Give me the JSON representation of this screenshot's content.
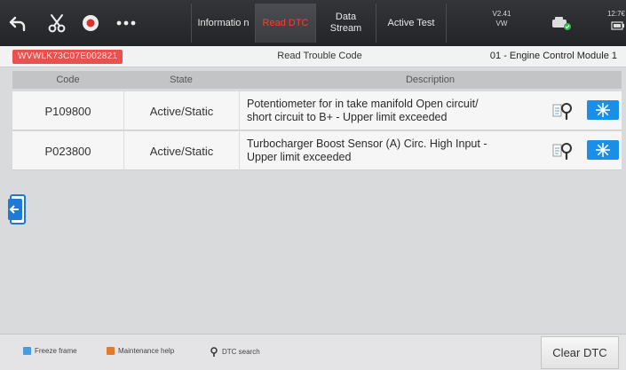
{
  "toolbar": {
    "icons": [
      "back-arrow-icon",
      "scissors-icon",
      "record-icon",
      "more-icon"
    ],
    "tabs": [
      {
        "label": "Informatio n",
        "active": false
      },
      {
        "label": "Read DTC",
        "active": true
      },
      {
        "label": "Data Stream",
        "active": false
      },
      {
        "label": "Active Test",
        "active": false
      }
    ],
    "version": "V2.41",
    "make": "VW",
    "time": "12:7€",
    "status_icons": [
      "vehicle-status-icon",
      "battery-icon"
    ]
  },
  "info": {
    "vin": "WVWLK73C07E002821",
    "title": "Read Trouble Code",
    "module": "01 - Engine Control Module 1"
  },
  "table": {
    "headers": [
      "Code",
      "State",
      "Description"
    ],
    "rows": [
      {
        "code": "P109800",
        "state": "Active/Static",
        "description_line1": "Potentiometer for in take manifold Open circuit/",
        "description_line2": "short circuit to B+ - Upper limit exceeded"
      },
      {
        "code": "P023800",
        "state": "Active/Static",
        "description_line1": "Turbocharger Boost Sensor (A) Circ. High Input -",
        "description_line2": "Upper limit exceeded"
      }
    ]
  },
  "legend": [
    {
      "label": "Freeze frame",
      "color": "#4a9be0",
      "icon": "freeze-frame-icon"
    },
    {
      "label": "Maintenance help",
      "color": "#e27a2c",
      "icon": "maintenance-help-icon"
    },
    {
      "label": "DTC search",
      "color": "#333333",
      "icon": "dtc-search-icon"
    }
  ],
  "clear_button": "Clear DTC",
  "colors": {
    "accent_red": "#e8514d",
    "active_tab": "#ff3d2e",
    "freeze_blue": "#1a8fe8"
  }
}
